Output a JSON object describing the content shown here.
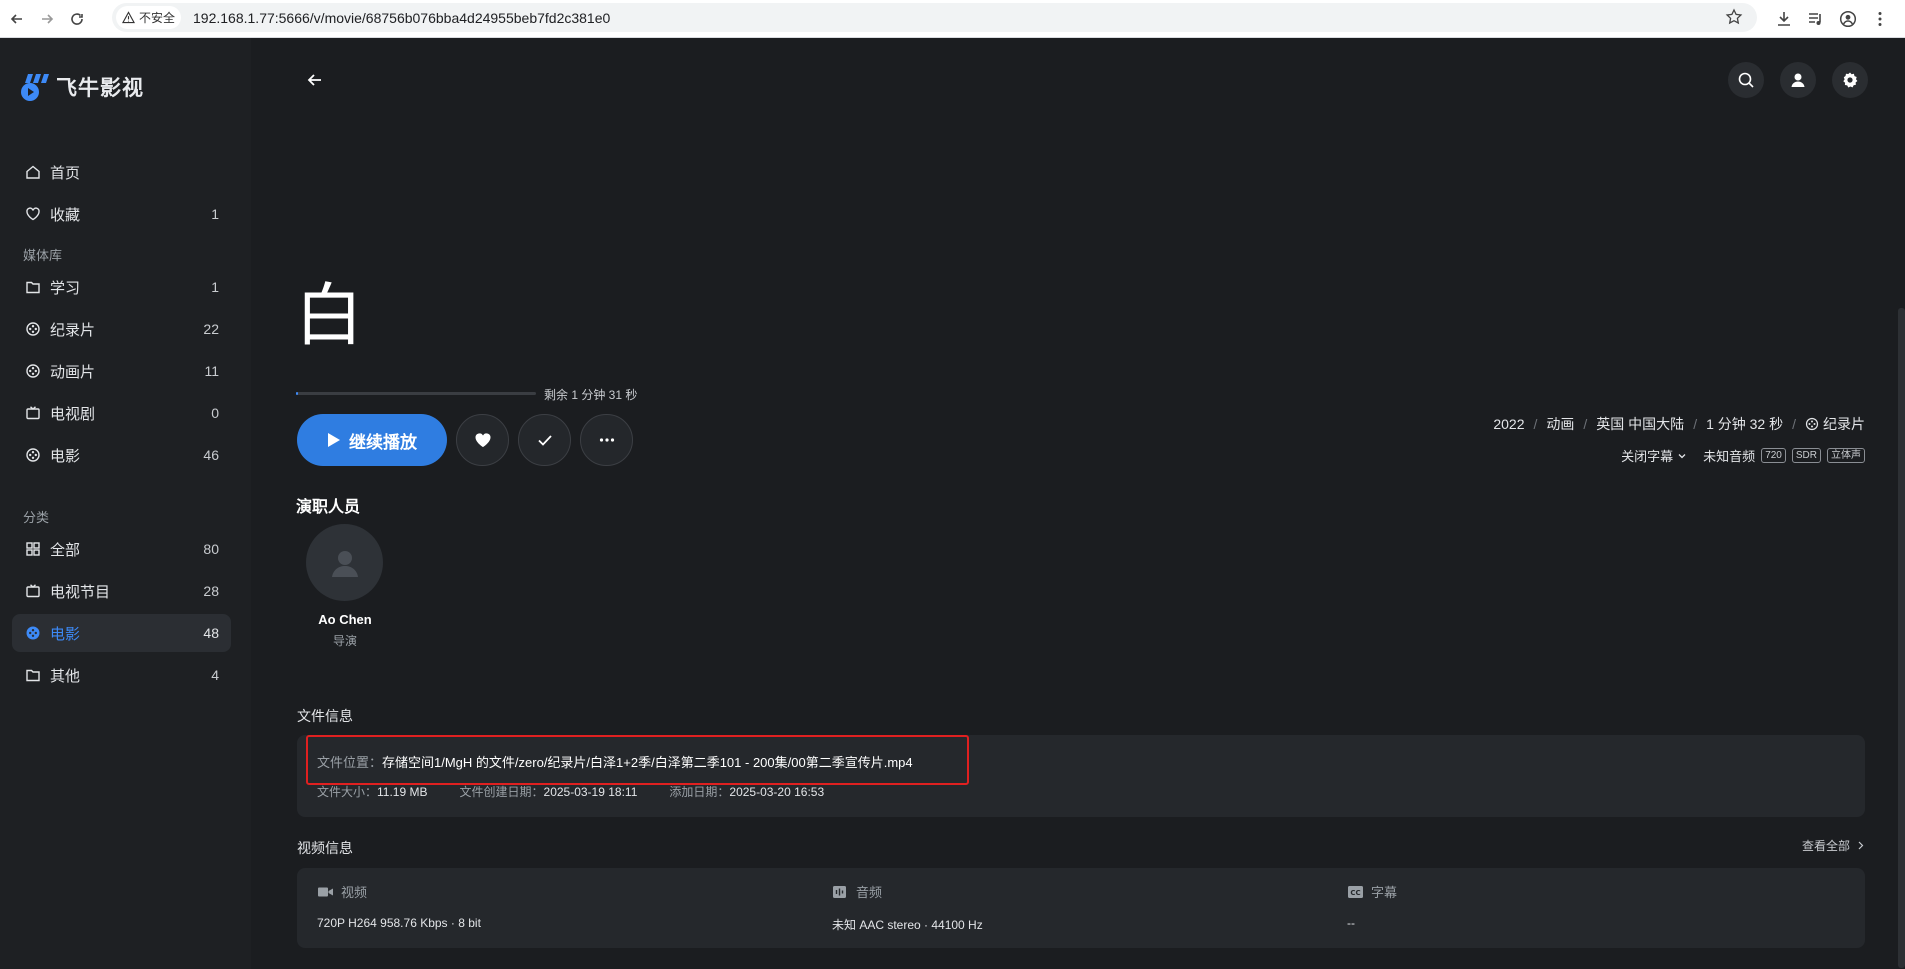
{
  "browser": {
    "security_label": "不安全",
    "url": "192.168.1.77:5666/v/movie/68756b076bba4d24955beb7fd2c381e0"
  },
  "app": {
    "name": "飞牛影视"
  },
  "sidebar": {
    "primary": [
      {
        "label": "首页",
        "count": ""
      },
      {
        "label": "收藏",
        "count": "1"
      }
    ],
    "library_label": "媒体库",
    "library": [
      {
        "label": "学习",
        "count": "1"
      },
      {
        "label": "纪录片",
        "count": "22"
      },
      {
        "label": "动画片",
        "count": "11"
      },
      {
        "label": "电视剧",
        "count": "0"
      },
      {
        "label": "电影",
        "count": "46"
      }
    ],
    "category_label": "分类",
    "categories": [
      {
        "label": "全部",
        "count": "80"
      },
      {
        "label": "电视节目",
        "count": "28"
      },
      {
        "label": "电影",
        "count": "48"
      },
      {
        "label": "其他",
        "count": "4"
      }
    ],
    "active_item": "电影"
  },
  "movie": {
    "title": "白",
    "remaining": "剩余 1 分钟 31 秒",
    "progress_fraction": 0.01,
    "play_label": "继续播放",
    "year": "2022",
    "genre": "动画",
    "regions": "英国 中国大陆",
    "duration": "1 分钟 32 秒",
    "library": "纪录片",
    "subtitle_option": "关闭字幕",
    "audio_option": "未知音频",
    "badges": [
      "720",
      "SDR",
      "立体声"
    ]
  },
  "cast": {
    "heading": "演职人员",
    "members": [
      {
        "name": "Ao Chen",
        "role": "导演"
      }
    ]
  },
  "file_info": {
    "heading": "文件信息",
    "location_label": "文件位置：",
    "location": "存储空间1/MgH 的文件/zero/纪录片/白泽1+2季/白泽第二季101 - 200集/00第二季宣传片.mp4",
    "size_label": "文件大小：",
    "size": "11.19 MB",
    "created_label": "文件创建日期：",
    "created": "2025-03-19 18:11",
    "added_label": "添加日期：",
    "added": "2025-03-20 16:53"
  },
  "video_info": {
    "heading": "视频信息",
    "view_all": "查看全部",
    "video_label": "视频",
    "video_value": "720P H264 958.76 Kbps · 8 bit",
    "audio_label": "音频",
    "audio_value": "未知 AAC stereo · 44100 Hz",
    "subtitle_label": "字幕",
    "subtitle_value": "--"
  },
  "colors": {
    "accent": "#2f7de1",
    "active_text": "#3d8af7",
    "highlight_box": "#e02020",
    "background": "#1b1d20"
  }
}
